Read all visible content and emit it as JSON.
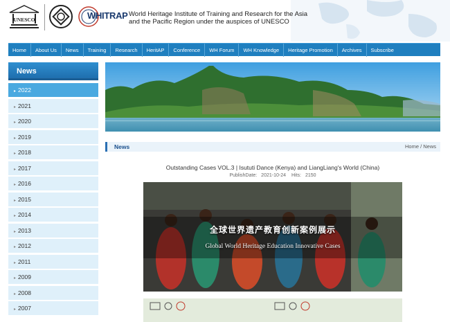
{
  "header": {
    "unesco_label": "UNESCO",
    "whitrap_label": "WHITRAP",
    "institute_name": "World Heritage Institute of Training and Research for the Asia and the Pacific Region under the auspices of UNESCO"
  },
  "nav": {
    "items": [
      "Home",
      "About Us",
      "News",
      "Training",
      "Research",
      "HeritAP",
      "Conference",
      "WH Forum",
      "WH Knowledge",
      "Heritage Promotion",
      "Archives",
      "Subscribe"
    ]
  },
  "sidebar": {
    "title": "News",
    "years": [
      "2022",
      "2021",
      "2020",
      "2019",
      "2018",
      "2017",
      "2016",
      "2015",
      "2014",
      "2013",
      "2012",
      "2011",
      "2009",
      "2008",
      "2007"
    ],
    "active_year": "2022"
  },
  "breadcrumb": {
    "section": "News",
    "path": "Home  / News"
  },
  "article": {
    "title": "Outstanding Cases VOL.3 | Isututi Dance (Kenya) and LiangLiang's World (China)",
    "publish_label": "PublishDate:",
    "publish_date": "2021-10-24",
    "hits_label": "Hits:",
    "hits": "2150",
    "image_caption_cn": "全球世界遗产教育创新案例展示",
    "image_caption_en": "Global World Heritage Education Innovative Cases"
  },
  "colors": {
    "nav_bg": "#1f7fbf",
    "sidebar_active": "#4aa9e0",
    "sidebar_item": "#dff0fa"
  }
}
